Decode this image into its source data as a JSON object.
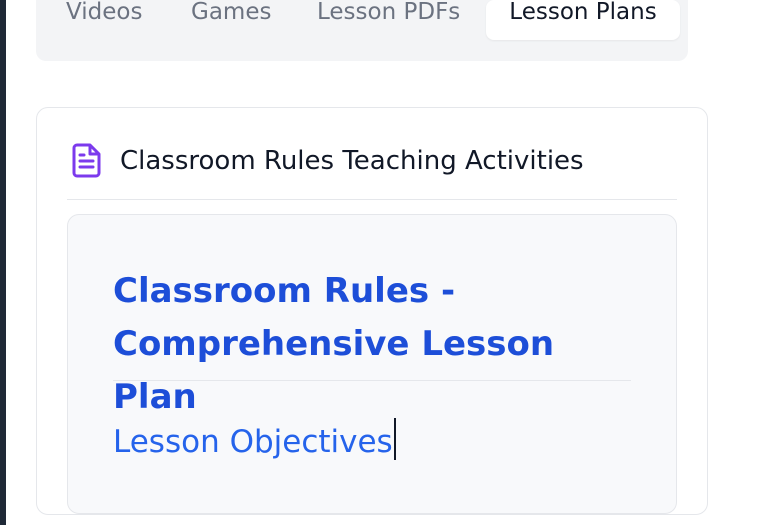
{
  "tabs": [
    {
      "label": "Videos",
      "active": false
    },
    {
      "label": "Games",
      "active": false
    },
    {
      "label": "Lesson PDFs",
      "active": false
    },
    {
      "label": "Lesson Plans",
      "active": true
    }
  ],
  "card": {
    "icon": "document-icon",
    "title": "Classroom Rules Teaching Activities"
  },
  "lesson": {
    "title": "Classroom Rules - Comprehensive Lesson Plan",
    "section_heading": "Lesson Objectives"
  },
  "colors": {
    "accent_purple": "#7c3aed",
    "heading_blue": "#1d4ed8",
    "subheading_blue": "#2563eb"
  }
}
